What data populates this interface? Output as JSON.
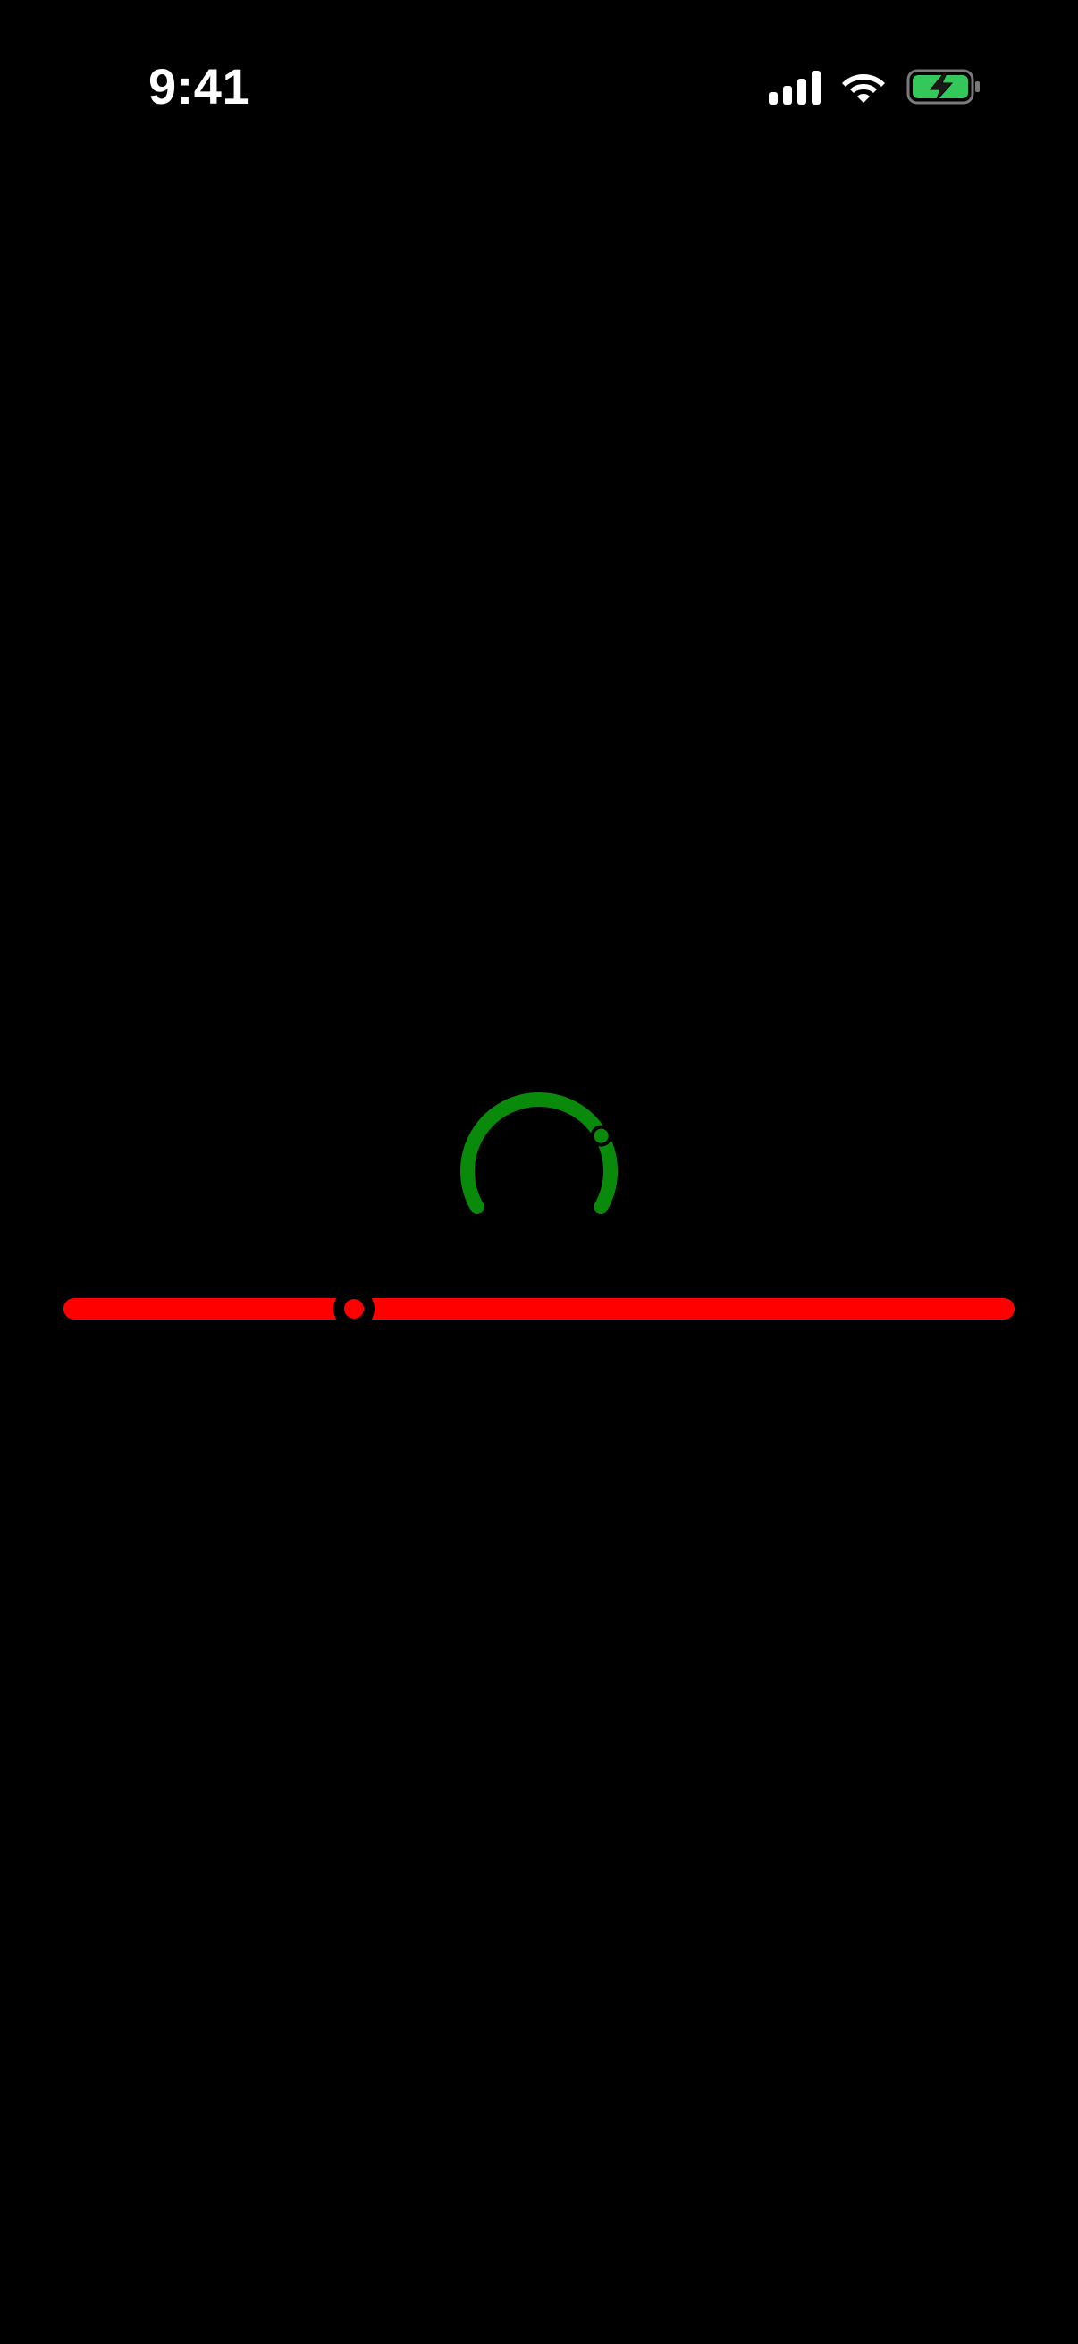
{
  "status_bar": {
    "time": "9:41",
    "icons": [
      "signal-icon",
      "wifi-icon",
      "battery-charging-icon"
    ],
    "battery_color": "#34C759"
  },
  "spinner": {
    "color": "#0A8A0A",
    "progress": 0.42
  },
  "slider": {
    "color": "#FF0000",
    "value": 0.305
  }
}
